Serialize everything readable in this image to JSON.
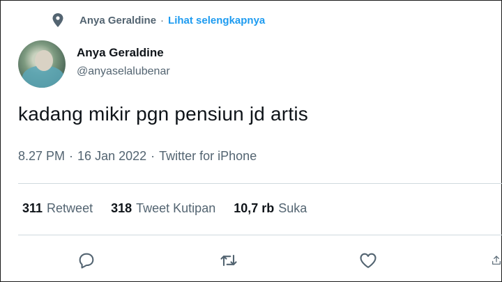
{
  "context": {
    "icon": "location-pin-icon",
    "name": "Anya Geraldine",
    "separator": "·",
    "link_label": "Lihat selengkapnya"
  },
  "author": {
    "display_name": "Anya Geraldine",
    "handle": "@anyaselalubenar"
  },
  "tweet": {
    "text": "kadang mikir pgn pensiun jd artis"
  },
  "meta": {
    "time": "8.27 PM",
    "separator": "·",
    "date": "16 Jan 2022",
    "separator2": "·",
    "source": "Twitter for iPhone"
  },
  "stats": {
    "retweets": {
      "count": "311",
      "label": "Retweet"
    },
    "quotes": {
      "count": "318",
      "label": "Tweet Kutipan"
    },
    "likes": {
      "count": "10,7 rb",
      "label": "Suka"
    }
  },
  "actions": {
    "reply_icon": "reply-icon",
    "retweet_icon": "retweet-icon",
    "like_icon": "heart-icon",
    "share_icon": "share-icon"
  },
  "colors": {
    "link": "#1d9bf0",
    "secondary_text": "#536471",
    "primary_text": "#0f1419"
  }
}
